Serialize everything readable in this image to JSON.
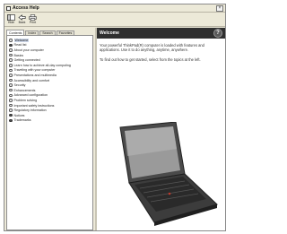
{
  "window": {
    "title": "Access Help",
    "close_glyph": "×"
  },
  "toolbar": {
    "buttons": [
      {
        "label": "Hide",
        "icon": "hide-icon"
      },
      {
        "label": "Back",
        "icon": "back-arrow-icon"
      },
      {
        "label": "Print",
        "icon": "printer-icon"
      }
    ]
  },
  "tabs": [
    "Contents",
    "Index",
    "Search",
    "Favorites"
  ],
  "tree": {
    "items": [
      "Welcome",
      "Read list",
      "About your computer",
      "Basics",
      "Getting connected",
      "Learn how to achieve all-day computing",
      "Traveling with your computer",
      "Presentations and multimedia",
      "Accessibility and comfort",
      "Security",
      "Enhancements",
      "Advanced configuration",
      "Problem solving",
      "Important safety instructions",
      "Regulatory information",
      "Notices",
      "Trademarks"
    ]
  },
  "content": {
    "header_title": "Welcome",
    "help_glyph": "?",
    "paragraphs": [
      "Your powerful ThinkPad(R) computer is loaded with features and applications. Use it to do anything, anytime, anywhere.",
      "To find out how to get started, select from the topics at the left."
    ]
  },
  "colors": {
    "header_bg": "#2f2f2f",
    "window_bg": "#ece9d8",
    "selection": "#ccd6e8"
  }
}
